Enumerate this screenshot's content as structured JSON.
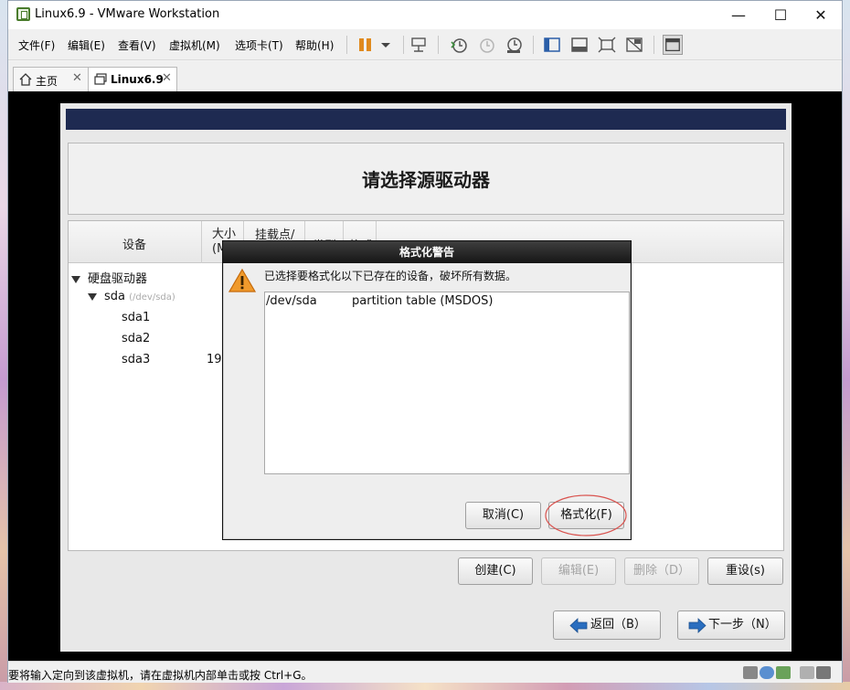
{
  "window": {
    "title": "Linux6.9 - VMware Workstation",
    "controls": {
      "minimize": "—",
      "maximize": "☐",
      "close": "✕"
    }
  },
  "menu": [
    {
      "label": "文件(F)"
    },
    {
      "label": "编辑(E)"
    },
    {
      "label": "查看(V)"
    },
    {
      "label": "虚拟机(M)"
    },
    {
      "label": "选项卡(T)"
    },
    {
      "label": "帮助(H)"
    }
  ],
  "toolbar_icons": [
    "pause-icon",
    "dropdown-icon",
    "send-ctrl-alt-del-icon",
    "snapshot-take-icon",
    "snapshot-revert-icon",
    "snapshot-manager-icon",
    "sidebar-icon",
    "console-view-icon",
    "fullscreen-icon",
    "unity-icon",
    "view-switch-icon"
  ],
  "tabs": [
    {
      "label": "主页",
      "close": "✕",
      "icon": "home-icon"
    },
    {
      "label": "Linux6.9",
      "close": "✕",
      "icon": "vm-icon"
    }
  ],
  "installer": {
    "title": "请选择源驱动器",
    "columns": [
      "设备",
      "大小\n(M",
      "挂载点/",
      "类型",
      "格式"
    ],
    "tree": {
      "root": "硬盘驱动器",
      "disk": "sda",
      "disk_path": "(/dev/sda)",
      "partitions": [
        {
          "name": "sda1",
          "size": ""
        },
        {
          "name": "sda2",
          "size": ""
        },
        {
          "name": "sda3",
          "size": "19"
        }
      ]
    },
    "buttons": {
      "create": "创建(C)",
      "edit": "编辑(E)",
      "delete": "删除（D）",
      "reset": "重设(s)",
      "back": "返回（B）",
      "next": "下一步（N）"
    }
  },
  "dialog": {
    "title": "格式化警告",
    "message": "已选择要格式化以下已存在的设备，破坏所有数据。",
    "devices": [
      {
        "device": "/dev/sda",
        "description": "partition table (MSDOS)"
      }
    ],
    "cancel_label": "取消(C)",
    "format_label": "格式化(F)"
  },
  "status": {
    "text": "要将输入定向到该虚拟机，请在虚拟机内部单击或按 Ctrl+G。"
  },
  "colors": {
    "banner": "#1e2a51",
    "highlight_circle": "#d9534f",
    "arrow_blue": "#2a6ebf"
  }
}
